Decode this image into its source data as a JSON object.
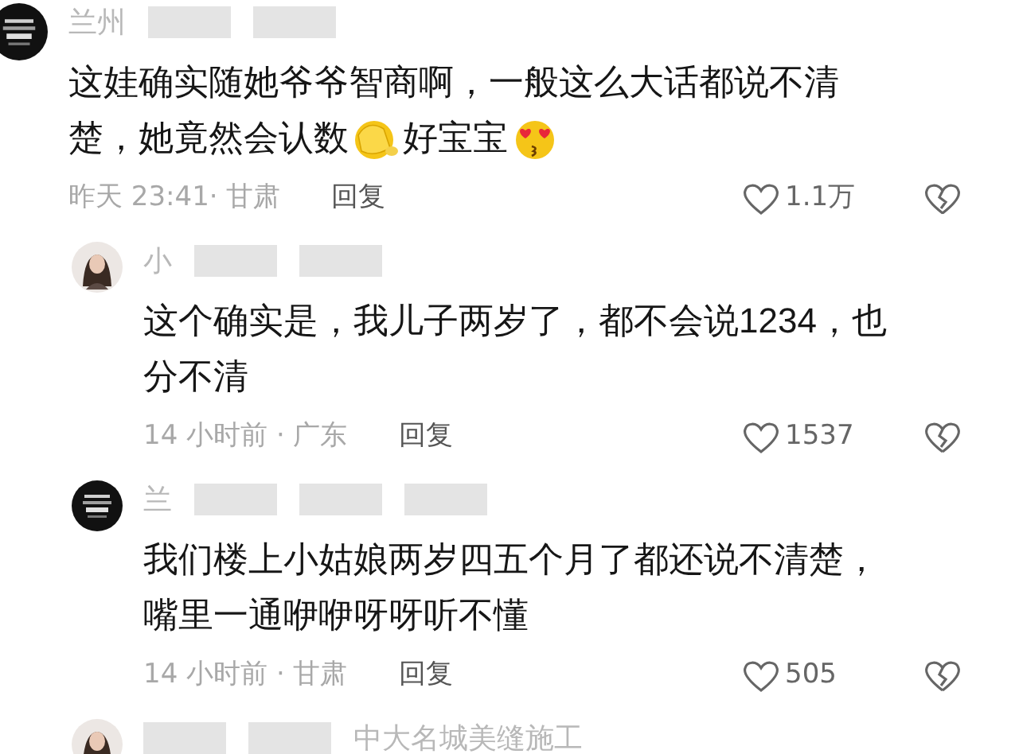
{
  "comments": [
    {
      "kind": "logo",
      "reply": false,
      "name_parts": [
        {
          "kind": "text",
          "text": "兰州"
        },
        {
          "kind": "blur"
        },
        {
          "kind": "blur"
        }
      ],
      "lines": [
        [
          {
            "kind": "text",
            "text": "这娃确实随她爷爷智商啊，一般这么大话都说不清"
          }
        ],
        [
          {
            "kind": "text",
            "text": "楚，她竟然会认数"
          },
          {
            "kind": "hug"
          },
          {
            "kind": "text",
            "text": "好宝宝"
          },
          {
            "kind": "hearteyes"
          }
        ]
      ],
      "time": "昨天 23:41· 甘肃",
      "reply_label": "回复",
      "likes": "1.1万"
    },
    {
      "kind": "person",
      "reply": true,
      "name_parts": [
        {
          "kind": "text",
          "text": "小"
        },
        {
          "kind": "blur"
        },
        {
          "kind": "blur"
        }
      ],
      "lines": [
        [
          {
            "kind": "text",
            "text": "这个确实是，我儿子两岁了，都不会说1234，也"
          }
        ],
        [
          {
            "kind": "text",
            "text": "分不清"
          }
        ]
      ],
      "time": "14 小时前 · 广东",
      "reply_label": "回复",
      "likes": "1537"
    },
    {
      "kind": "logo",
      "reply": true,
      "name_parts": [
        {
          "kind": "text",
          "text": "兰"
        },
        {
          "kind": "blur"
        },
        {
          "kind": "blur"
        },
        {
          "kind": "blur"
        }
      ],
      "lines": [
        [
          {
            "kind": "text",
            "text": "我们楼上小姑娘两岁四五个月了都还说不清楚，"
          }
        ],
        [
          {
            "kind": "text",
            "text": "嘴里一通咿咿呀呀听不懂"
          }
        ]
      ],
      "time": "14 小时前 · 甘肃",
      "reply_label": "回复",
      "likes": "505"
    },
    {
      "kind": "person",
      "reply": true,
      "name_parts": [
        {
          "kind": "blur"
        },
        {
          "kind": "blur"
        },
        {
          "kind": "text",
          "text": "中大名城美缝施工"
        }
      ]
    }
  ]
}
